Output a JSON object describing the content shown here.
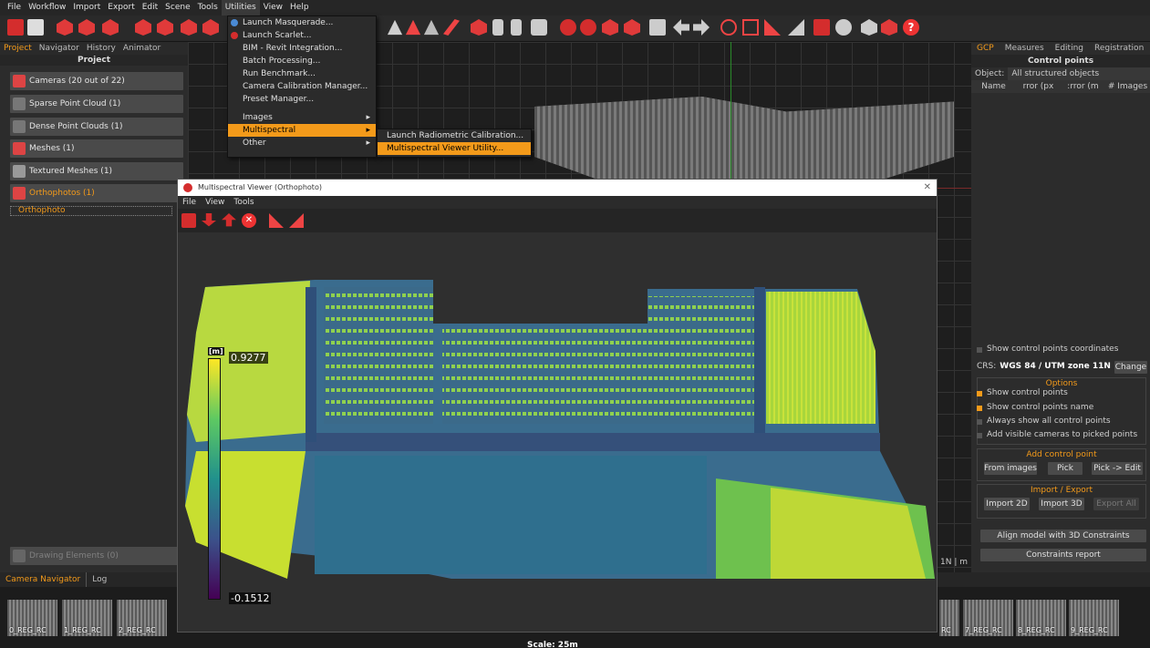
{
  "menubar": [
    "File",
    "Workflow",
    "Import",
    "Export",
    "Edit",
    "Scene",
    "Tools",
    "Utilities",
    "View",
    "Help"
  ],
  "left_panel": {
    "tabs": [
      "Project",
      "Navigator",
      "History",
      "Animator"
    ],
    "title": "Project",
    "items": [
      {
        "label": "Cameras (20 out of 22)",
        "icon": "cameras-icon"
      },
      {
        "label": "Sparse Point Cloud (1)",
        "icon": "sparse-cloud-icon"
      },
      {
        "label": "Dense Point Clouds (1)",
        "icon": "dense-cloud-icon"
      },
      {
        "label": "Meshes (1)",
        "icon": "mesh-icon"
      },
      {
        "label": "Textured Meshes (1)",
        "icon": "textured-mesh-icon"
      },
      {
        "label": "Orthophotos (1)",
        "icon": "orthophoto-icon"
      }
    ],
    "selected_child": "Orthophoto",
    "drawing_elements": "Drawing Elements (0)"
  },
  "utilities_menu": {
    "items": [
      "Launch Masquerade...",
      "Launch Scarlet...",
      "BIM - Revit Integration...",
      "Batch Processing...",
      "Run Benchmark...",
      "Camera Calibration Manager...",
      "Preset Manager..."
    ],
    "submenus": [
      "Images",
      "Multispectral",
      "Other"
    ],
    "multispectral_items": [
      "Launch Radiometric Calibration...",
      "Multispectral Viewer Utility..."
    ]
  },
  "right_panel": {
    "tabs": [
      "GCP",
      "Measures",
      "Editing",
      "Registration"
    ],
    "title": "Control points",
    "object_label": "Object:",
    "object_value": "All structured objects",
    "columns": [
      "Name",
      "rror (px",
      ":rror (m",
      "# Images"
    ],
    "show_coords": "Show control points coordinates",
    "crs_label": "CRS:",
    "crs_value": "WGS 84 / UTM zone 11N",
    "change": "Change",
    "options_title": "Options",
    "options": [
      {
        "label": "Show control points",
        "checked": true
      },
      {
        "label": "Show control points name",
        "checked": true
      },
      {
        "label": "Always show all control points",
        "checked": false
      },
      {
        "label": "Add visible cameras to picked points",
        "checked": false
      }
    ],
    "add_title": "Add control point",
    "add_buttons": [
      "From images",
      "Pick",
      "Pick -> Edit"
    ],
    "import_title": "Import / Export",
    "import_buttons": [
      "Import 2D",
      "Import 3D",
      "Export All"
    ],
    "align_button": "Align model with 3D Constraints",
    "report_button": "Constraints report"
  },
  "viewer": {
    "title": "Multispectral Viewer (Orthophoto)",
    "menu": [
      "File",
      "View",
      "Tools"
    ],
    "colorbar_unit": "[m]",
    "colorbar_max": "0.9277",
    "colorbar_min": "-0.1512",
    "scale_label": "Scale: 25m"
  },
  "viewport_status": "1N  | m",
  "bottom_tabs": [
    "Camera Navigator",
    "Log"
  ],
  "thumbnails": [
    "0_REG_RC",
    "1_REG_RC",
    "2_REG_RC",
    "RC",
    "7_REG_RC",
    "8_REG_RC",
    "9_REG_RC"
  ]
}
